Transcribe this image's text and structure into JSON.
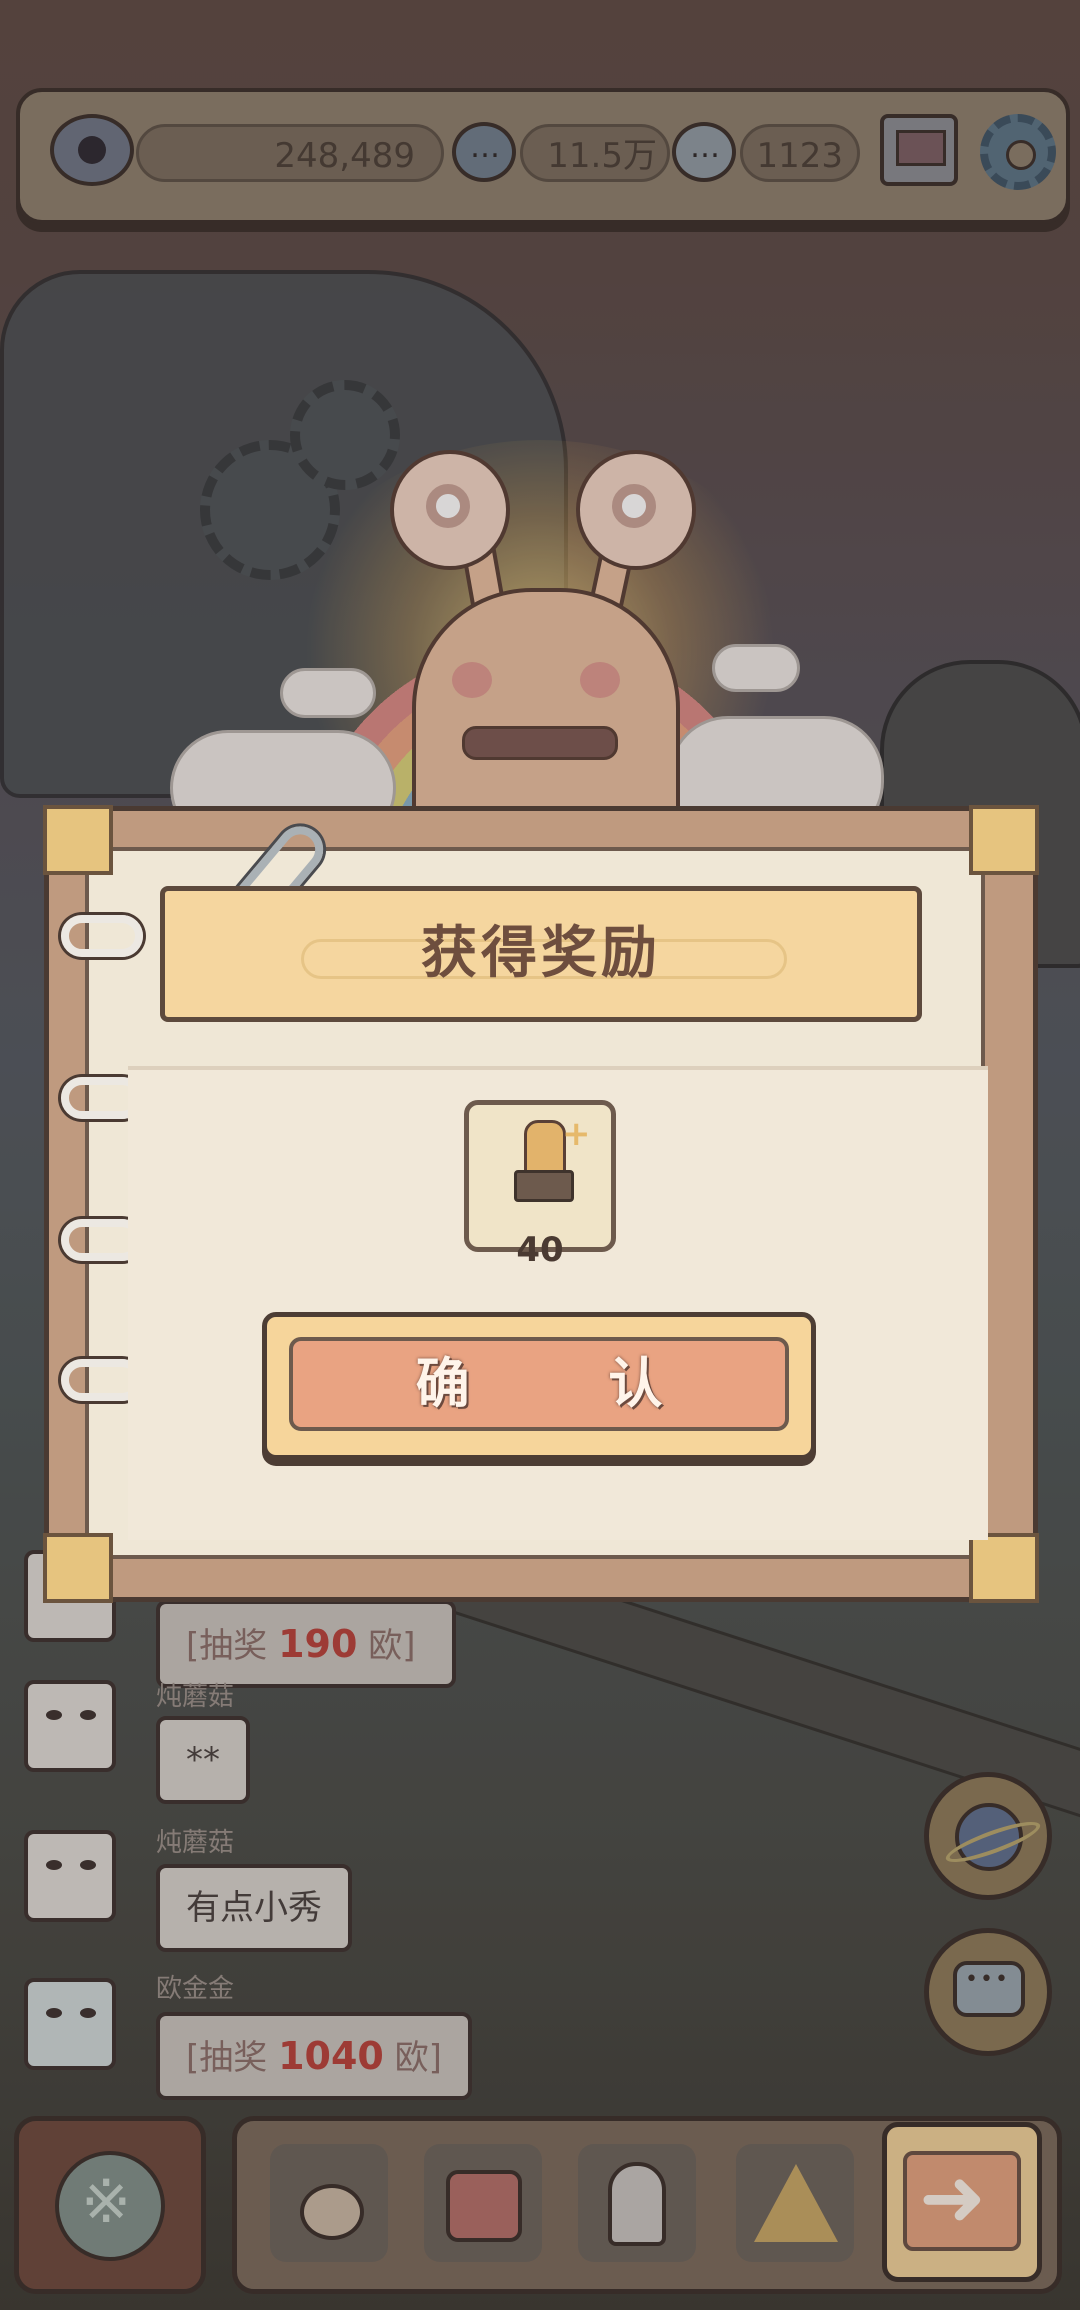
{
  "stats": {
    "views": "248,489",
    "comments": "11.5万",
    "messages": "1123"
  },
  "dialog": {
    "title": "获得奖励",
    "reward": {
      "icon": "trophy-hand-icon",
      "count": "40"
    },
    "confirm_label": "确 认"
  },
  "chat": [
    {
      "user": "",
      "text_prefix": "[抽奖 ",
      "amount": "190",
      "text_suffix": " 欧]",
      "type": "lottery"
    },
    {
      "user": "炖蘑菇",
      "text": "**",
      "type": "text"
    },
    {
      "user": "炖蘑菇",
      "text": "有点小秀",
      "type": "text"
    },
    {
      "user": "欧金金",
      "text_prefix": "[抽奖 ",
      "amount": "1040",
      "text_suffix": " 欧]",
      "type": "lottery"
    }
  ],
  "colors": {
    "banner": "#f5d69f",
    "confirm": "#e9a382",
    "lottery_amount": "#b8433b"
  }
}
